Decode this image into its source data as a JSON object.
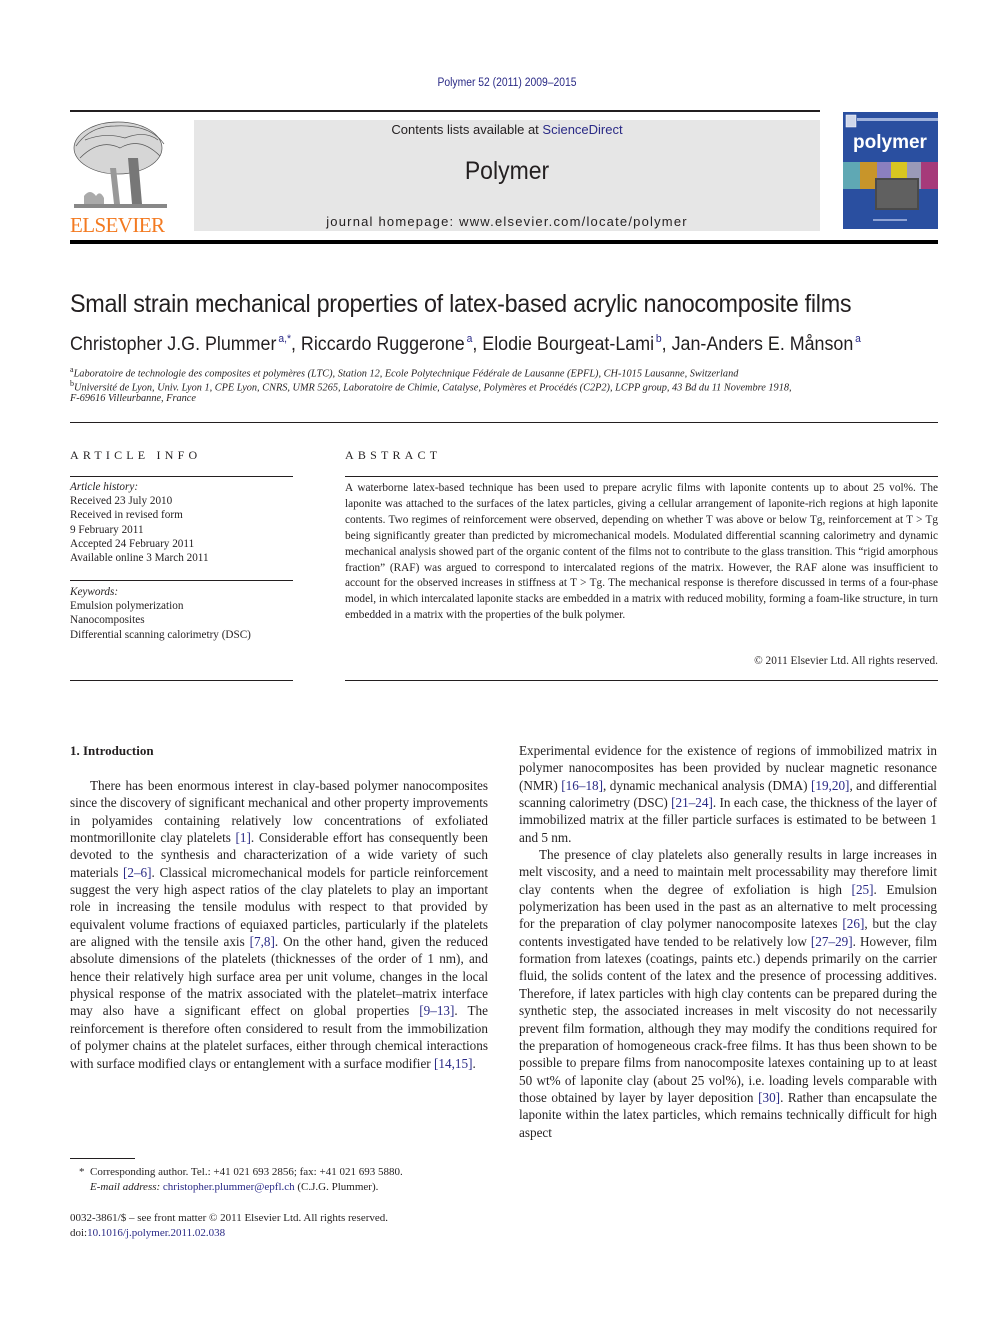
{
  "header": {
    "citation": "Polymer 52 (2011) 2009–2015",
    "contents_prefix": "Contents lists available at ",
    "contents_link": "ScienceDirect",
    "journal_title": "Polymer",
    "homepage": "journal homepage: www.elsevier.com/locate/polymer",
    "publisher_logo_text": "ELSEVIER",
    "cover_title": "polymer"
  },
  "article": {
    "title": "Small strain mechanical properties of latex-based acrylic nanocomposite films",
    "authors": [
      {
        "name": "Christopher J.G. Plummer",
        "sup": "a,*",
        "sep": ", "
      },
      {
        "name": "Riccardo Ruggerone",
        "sup": "a",
        "sep": ", "
      },
      {
        "name": "Elodie Bourgeat-Lami",
        "sup": "b",
        "sep": ", "
      },
      {
        "name": "Jan-Anders E. Månson",
        "sup": "a",
        "sep": ""
      }
    ],
    "affiliations": [
      {
        "mark": "a",
        "text": "Laboratoire de technologie des composites et polymères (LTC), Station 12, Ecole Polytechnique Fédérale de Lausanne (EPFL), CH-1015 Lausanne, Switzerland"
      },
      {
        "mark": "b",
        "text": "Université de Lyon, Univ. Lyon 1, CPE Lyon, CNRS, UMR 5265, Laboratoire de Chimie, Catalyse, Polymères et Procédés (C2P2), LCPP group, 43 Bd du 11 Novembre 1918,"
      },
      {
        "mark": "",
        "text": "F-69616 Villeurbanne, France"
      }
    ]
  },
  "article_info": {
    "label": "ARTICLE INFO",
    "history_label": "Article history:",
    "history": [
      "Received 23 July 2010",
      "Received in revised form",
      "9 February 2011",
      "Accepted 24 February 2011",
      "Available online 3 March 2011"
    ],
    "keywords_label": "Keywords:",
    "keywords": [
      "Emulsion polymerization",
      "Nanocomposites",
      "Differential scanning calorimetry (DSC)"
    ]
  },
  "abstract": {
    "label": "ABSTRACT",
    "text": "A waterborne latex-based technique has been used to prepare acrylic films with laponite contents up to about 25 vol%. The laponite was attached to the surfaces of the latex particles, giving a cellular arrangement of laponite-rich regions at high laponite contents. Two regimes of reinforcement were observed, depending on whether T was above or below Tg, reinforcement at T > Tg being significantly greater than predicted by micromechanical models. Modulated differential scanning calorimetry and dynamic mechanical analysis showed part of the organic content of the films not to contribute to the glass transition. This “rigid amorphous fraction” (RAF) was argued to correspond to intercalated regions of the matrix. However, the RAF alone was insufficient to account for the observed increases in stiffness at T > Tg. The mechanical response is therefore discussed in terms of a four-phase model, in which intercalated laponite stacks are embedded in a matrix with reduced mobility, forming a foam-like structure, in turn embedded in a matrix with the properties of the bulk polymer.",
    "copyright": "© 2011 Elsevier Ltd. All rights reserved."
  },
  "body": {
    "section_heading": "1.  Introduction",
    "left_paragraphs": [
      [
        {
          "t": "There has been enormous interest in clay-based polymer nanocomposites since the discovery of significant mechanical and other property improvements in polyamides containing relatively low concentrations of exfoliated montmorillonite clay platelets "
        },
        {
          "ref": "[1]"
        },
        {
          "t": ". Considerable effort has consequently been devoted to the synthesis and characterization of a wide variety of such materials "
        },
        {
          "ref": "[2–6]"
        },
        {
          "t": ". Classical micromechanical models for particle reinforcement suggest the very high aspect ratios of the clay platelets to play an important role in increasing the tensile modulus with respect to that provided by equivalent volume fractions of equiaxed particles, particularly if the platelets are aligned with the tensile axis "
        },
        {
          "ref": "[7,8]"
        },
        {
          "t": ". On the other hand, given the reduced absolute dimensions of the platelets (thicknesses of the order of 1 nm), and hence their relatively high surface area per unit volume, changes in the local physical response of the matrix associated with the platelet–matrix interface may also have a significant effect on global properties "
        },
        {
          "ref": "[9–13]"
        },
        {
          "t": ". The reinforcement is therefore often considered to result from the immobilization of polymer chains at the platelet surfaces, either through chemical interactions with surface modified clays or entanglement with a surface modifier "
        },
        {
          "ref": "[14,15]"
        },
        {
          "t": "."
        }
      ]
    ],
    "right_paragraphs": [
      [
        {
          "t": "Experimental evidence for the existence of regions of immobilized matrix in polymer nanocomposites has been provided by nuclear magnetic resonance (NMR) "
        },
        {
          "ref": "[16–18]"
        },
        {
          "t": ", dynamic mechanical analysis (DMA) "
        },
        {
          "ref": "[19,20]"
        },
        {
          "t": ", and differential scanning calorimetry (DSC) "
        },
        {
          "ref": "[21–24]"
        },
        {
          "t": ". In each case, the thickness of the layer of immobilized matrix at the filler particle surfaces is estimated to be between 1 and 5 nm."
        }
      ],
      [
        {
          "t": "The presence of clay platelets also generally results in large increases in melt viscosity, and a need to maintain melt processability may therefore limit clay contents when the degree of exfoliation is high "
        },
        {
          "ref": "[25]"
        },
        {
          "t": ". Emulsion polymerization has been used in the past as an alternative to melt processing for the preparation of clay polymer nanocomposite latexes "
        },
        {
          "ref": "[26]"
        },
        {
          "t": ", but the clay contents investigated have tended to be relatively low "
        },
        {
          "ref": "[27–29]"
        },
        {
          "t": ". However, film formation from latexes (coatings, paints etc.) depends primarily on the carrier fluid, the solids content of the latex and the presence of processing additives. Therefore, if latex particles with high clay contents can be prepared during the synthetic step, the associated increases in melt viscosity do not necessarily prevent film formation, although they may modify the conditions required for the preparation of homogeneous crack-free films. It has thus been shown to be possible to prepare films from nanocomposite latexes containing up to at least 50 wt% of laponite clay (about 25 vol%), i.e. loading levels comparable with those obtained by layer by layer deposition "
        },
        {
          "ref": "[30]"
        },
        {
          "t": ". Rather than encapsulate the laponite within the latex particles, which remains technically difficult for high aspect"
        }
      ]
    ]
  },
  "footnote": {
    "mark": "*",
    "corresponding": "Corresponding author. Tel.: +41 021 693 2856; fax: +41 021 693 5880.",
    "email_label": "E-mail address:",
    "email": "christopher.plummer@epfl.ch",
    "email_suffix": " (C.J.G. Plummer)."
  },
  "front_matter": {
    "issn_line": "0032-3861/$ – see front matter © 2011 Elsevier Ltd. All rights reserved.",
    "doi_prefix": "doi:",
    "doi": "10.1016/j.polymer.2011.02.038"
  },
  "colors": {
    "link": "#2a2a86",
    "elsevier_orange": "#f37a21",
    "banner_gray": "#e6e6e6",
    "cover_blue": "#2a4fa0"
  }
}
